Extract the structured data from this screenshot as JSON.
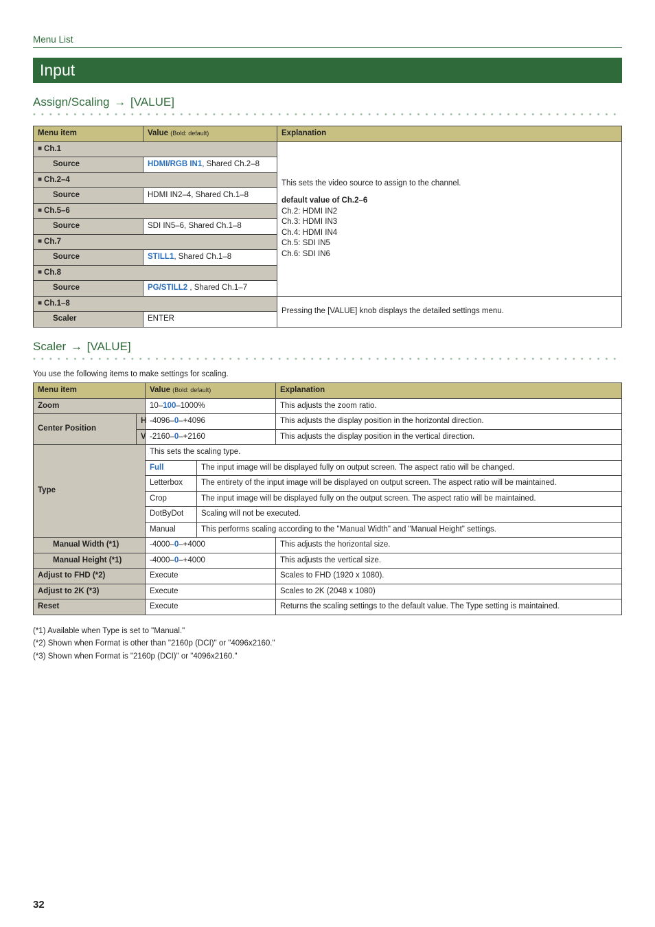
{
  "header": {
    "menu_list": "Menu List"
  },
  "section": {
    "input": "Input"
  },
  "assign": {
    "title_a": "Assign/Scaling",
    "title_b": "[VALUE]",
    "cols": {
      "menu_item": "Menu item",
      "value": "Value",
      "value_small": "(Bold: default)",
      "explanation": "Explanation"
    },
    "rows": {
      "ch1": "Ch.1",
      "src1_label": "Source",
      "src1_v1": "HDMI/RGB IN1",
      "src1_v2": ", Shared Ch.2–8",
      "ch2_4": "Ch.2–4",
      "src2_label": "Source",
      "src2_val": "HDMI IN2–4, Shared Ch.1–8",
      "ch5_6": "Ch.5–6",
      "src3_label": "Source",
      "src3_val": "SDI IN5–6, Shared Ch.1–8",
      "ch7": "Ch.7",
      "src4_label": "Source",
      "src4_v1": "STILL1",
      "src4_v2": ", Shared Ch.1–8",
      "ch8": "Ch.8",
      "src5_label": "Source",
      "src5_v1": "PG/STILL2",
      "src5_v2": " , Shared Ch.1–7",
      "ch1_8": "Ch.1–8",
      "scaler_label": "Scaler",
      "scaler_val": "ENTER"
    },
    "expl": {
      "line1": "This sets the video source to assign to the channel.",
      "line3": "default value of Ch.2–6",
      "l4": "Ch.2: HDMI IN2",
      "l5": "Ch.3: HDMI IN3",
      "l6": "Ch.4: HDMI IN4",
      "l7": "Ch.5: SDI IN5",
      "l8": "Ch.6: SDI IN6",
      "scaler": "Pressing the [VALUE] knob displays the detailed settings menu."
    }
  },
  "scaler": {
    "title_a": "Scaler",
    "title_b": "[VALUE]",
    "intro": "You use the following items to make settings for scaling.",
    "cols": {
      "menu_item": "Menu item",
      "value": "Value",
      "value_small": "(Bold: default)",
      "explanation": "Explanation"
    },
    "rows": {
      "zoom": "Zoom",
      "zoom_v_a": "10–",
      "zoom_v_b": "100",
      "zoom_v_c": "–1000%",
      "zoom_e": "This adjusts the zoom ratio.",
      "cpos": "Center Position",
      "cpos_h": "H",
      "cpos_h_a": "-4096–",
      "cpos_h_b": "0",
      "cpos_h_c": "–+4096",
      "cpos_h_e": "This adjusts the display position in the horizontal direction.",
      "cpos_v": "V",
      "cpos_v_a": "-2160–",
      "cpos_v_b": "0",
      "cpos_v_c": "–+2160",
      "cpos_v_e": "This adjusts the display position in the vertical direction.",
      "type": "Type",
      "type_head": "This sets the scaling type.",
      "type_full": "Full",
      "type_full_e": "The input image will be displayed fully on output screen. The aspect ratio will be changed.",
      "type_lbox": "Letterbox",
      "type_lbox_e": "The entirety of the input image will be displayed on output screen. The aspect ratio will be maintained.",
      "type_crop": "Crop",
      "type_crop_e": "The input image will be displayed fully on the output screen. The aspect ratio will be maintained.",
      "type_dbd": "DotByDot",
      "type_dbd_e": "Scaling will not be executed.",
      "type_man": "Manual",
      "type_man_e": "This performs scaling according to the \"Manual Width\" and \"Manual Height\" settings.",
      "mw": "Manual Width (*1)",
      "mw_v_a": "-4000–",
      "mw_v_b": "0",
      "mw_v_c": "–+4000",
      "mw_e": "This adjusts the horizontal size.",
      "mh": "Manual Height (*1)",
      "mh_v_a": "-4000–",
      "mh_v_b": "0",
      "mh_v_c": "–+4000",
      "mh_e": "This adjusts the vertical size.",
      "afhd": "Adjust to FHD (*2)",
      "afhd_v": "Execute",
      "afhd_e": "Scales to FHD (1920 x 1080).",
      "a2k": "Adjust to 2K (*3)",
      "a2k_v": "Execute",
      "a2k_e": "Scales to 2K (2048 x 1080)",
      "reset": "Reset",
      "reset_v": "Execute",
      "reset_e": "Returns the scaling settings to the default value. The Type setting is maintained."
    }
  },
  "footnotes": {
    "n1": "(*1)   Available when Type is set to \"Manual.\"",
    "n2": "(*2)   Shown when Format is other than \"2160p (DCI)\" or \"4096x2160.\"",
    "n3": "(*3)   Shown when Format is \"2160p (DCI)\" or \"4096x2160.\""
  },
  "page_num": "32"
}
